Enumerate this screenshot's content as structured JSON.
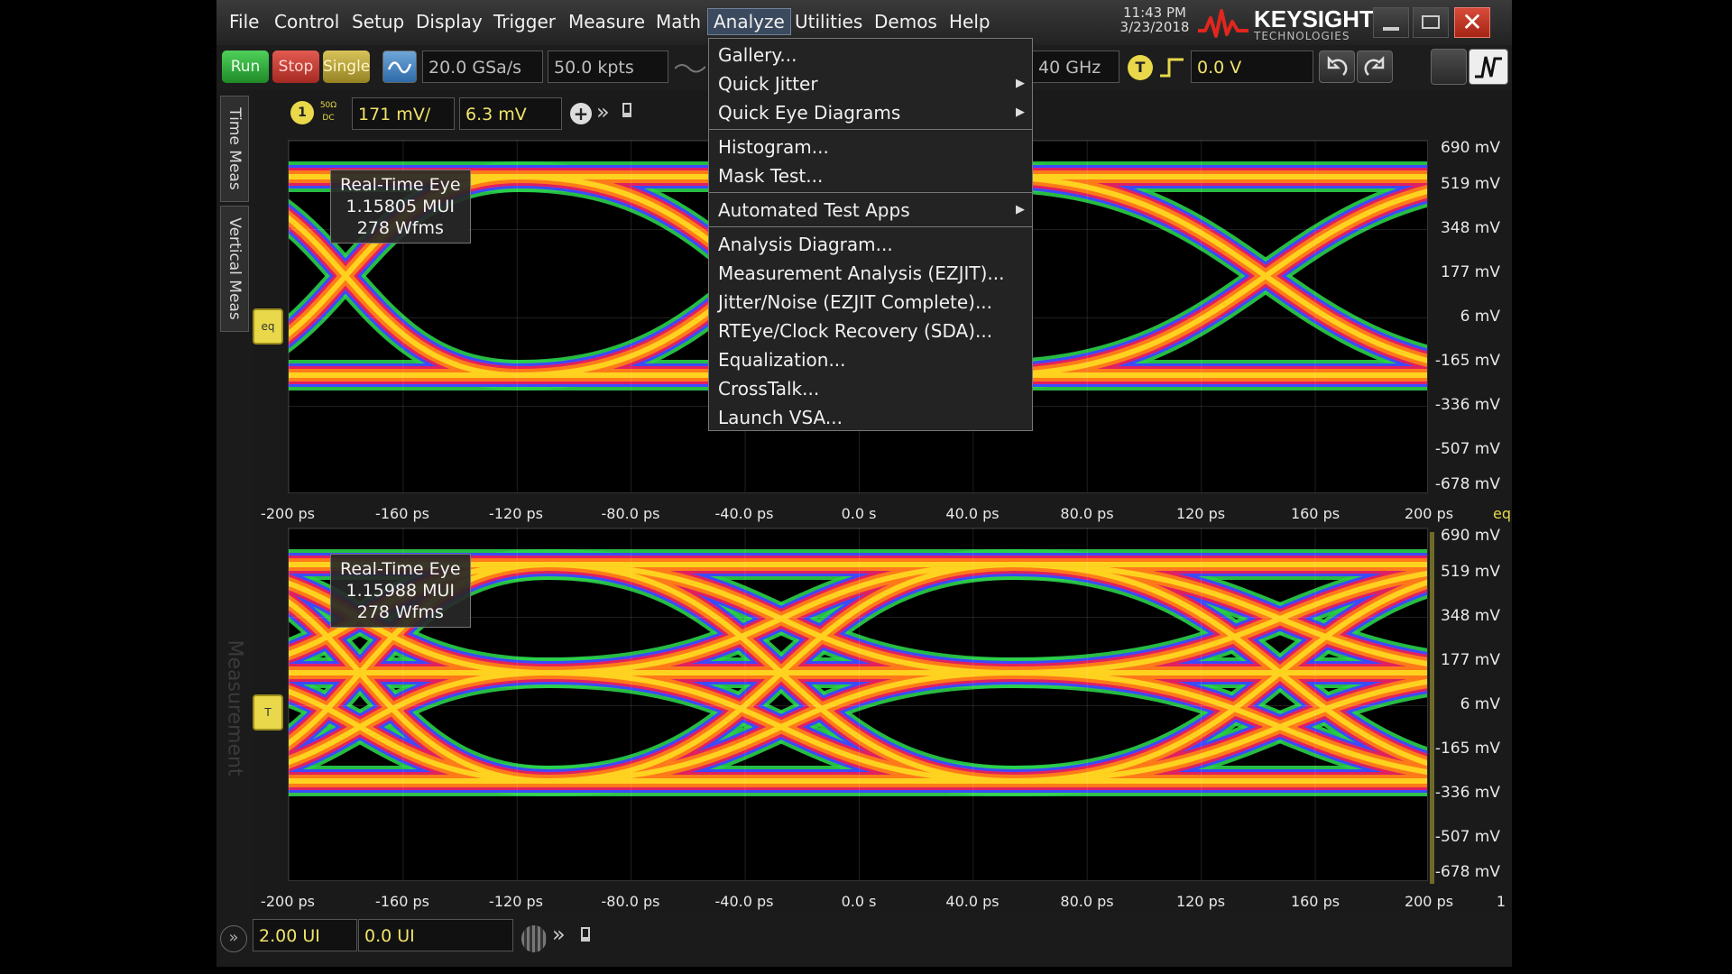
{
  "menubar": {
    "items": [
      "File",
      "Control",
      "Setup",
      "Display",
      "Trigger",
      "Measure",
      "Math",
      "Analyze",
      "Utilities",
      "Demos",
      "Help"
    ],
    "active": "Analyze",
    "time": "11:43 PM",
    "date": "3/23/2018",
    "brand": "KEYSIGHT",
    "brand_sub": "TECHNOLOGIES"
  },
  "toolbar": {
    "run": "Run",
    "stop": "Stop",
    "single": "Single",
    "sample_rate": "20.0 GSa/s",
    "memory_depth": "50.0 kpts",
    "bandwidth": "40 GHz",
    "trigger_icon": "T",
    "trigger_level": "0.0 V"
  },
  "left_tabs": [
    "Time Meas",
    "Vertical Meas"
  ],
  "background_tab": "Measurement",
  "markers": {
    "top": "eq",
    "bottom": "T"
  },
  "channel": {
    "number": "1",
    "coupling_top": "50Ω",
    "coupling_bottom": "DC",
    "scale": "171 mV/",
    "offset": "6.3 mV"
  },
  "plots": [
    {
      "info": {
        "title": "Real-Time Eye",
        "mui": "1.15805 MUI",
        "wfms": "278 Wfms"
      },
      "y_labels": [
        "690 mV",
        "519 mV",
        "348 mV",
        "177 mV",
        "6 mV",
        "-165 mV",
        "-336 mV",
        "-507 mV",
        "-678 mV"
      ],
      "x_labels": [
        "-200 ps",
        "-160 ps",
        "-120 ps",
        "-80.0 ps",
        "-40.0 ps",
        "0.0 s",
        "40.0 ps",
        "80.0 ps",
        "120 ps",
        "160 ps",
        "200 ps"
      ],
      "x_end_label": "eq"
    },
    {
      "info": {
        "title": "Real-Time Eye",
        "mui": "1.15988 MUI",
        "wfms": "278 Wfms"
      },
      "y_labels": [
        "690 mV",
        "519 mV",
        "348 mV",
        "177 mV",
        "6 mV",
        "-165 mV",
        "-336 mV",
        "-507 mV",
        "-678 mV"
      ],
      "x_labels": [
        "-200 ps",
        "-160 ps",
        "-120 ps",
        "-80.0 ps",
        "-40.0 ps",
        "0.0 s",
        "40.0 ps",
        "80.0 ps",
        "120 ps",
        "160 ps",
        "200 ps"
      ],
      "x_end_label": "1"
    }
  ],
  "analyze_menu": {
    "items": [
      {
        "label": "Gallery...",
        "submenu": false
      },
      {
        "label": "Quick Jitter",
        "submenu": true
      },
      {
        "label": "Quick Eye Diagrams",
        "submenu": true
      },
      {
        "label": "Histogram...",
        "submenu": false
      },
      {
        "label": "Mask Test...",
        "submenu": false
      },
      {
        "label": "Automated Test Apps",
        "submenu": true
      },
      {
        "label": "Analysis Diagram...",
        "submenu": false
      },
      {
        "label": "Measurement Analysis (EZJIT)...",
        "submenu": false
      },
      {
        "label": "Jitter/Noise (EZJIT Complete)...",
        "submenu": false
      },
      {
        "label": "RTEye/Clock Recovery (SDA)...",
        "submenu": false
      },
      {
        "label": "Equalization...",
        "submenu": false
      },
      {
        "label": "CrossTalk...",
        "submenu": false
      },
      {
        "label": "Launch VSA...",
        "submenu": false
      }
    ]
  },
  "bottombar": {
    "horizontal_scale": "2.00 UI",
    "horizontal_position": "0.0 UI"
  },
  "colors": {
    "eye_core": "#ffd21f",
    "eye_mid": "#ff7a18",
    "eye_edge": "#e02060",
    "eye_outer": "#3b4bff",
    "eye_halo": "#2ad04a",
    "channel_yellow": "#e8d84a",
    "close_red": "#c9342a"
  }
}
